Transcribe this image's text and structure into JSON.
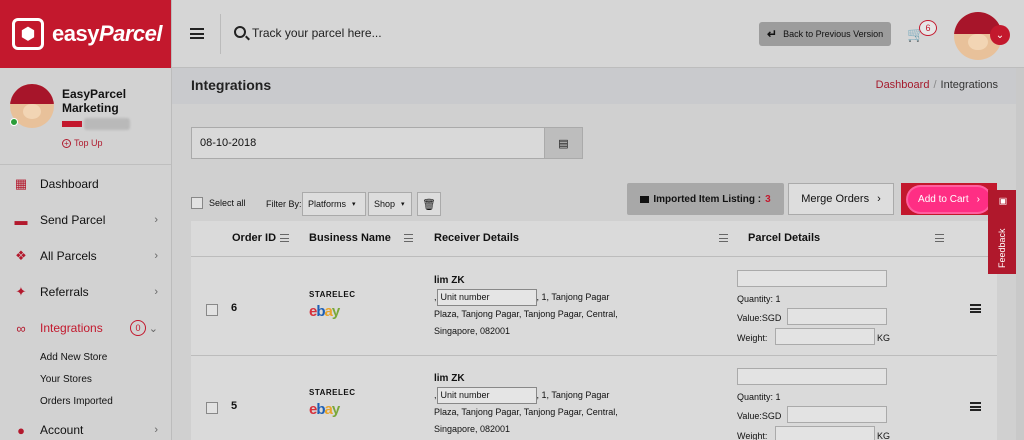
{
  "brand": {
    "logo_symbol": "⬢",
    "name_a": "easy",
    "name_b": "Parcel",
    "color": "#c3182d"
  },
  "profile": {
    "name": "EasyParcel Marketing",
    "topup": "Top Up",
    "status": "online"
  },
  "sidebar": {
    "items": [
      {
        "label": "Dashboard",
        "icon": "dashboard-icon",
        "glyph": "▦"
      },
      {
        "label": "Send Parcel",
        "icon": "truck-icon",
        "glyph": "▬",
        "chev": "›"
      },
      {
        "label": "All Parcels",
        "icon": "boxes-icon",
        "glyph": "❖",
        "chev": "›"
      },
      {
        "label": "Referrals",
        "icon": "users-icon",
        "glyph": "✦",
        "chev": "›"
      },
      {
        "label": "Integrations",
        "icon": "link-icon",
        "glyph": "∞",
        "badge": "0",
        "chev": "⌄"
      },
      {
        "label": "Account",
        "icon": "account-icon",
        "glyph": "●",
        "chev": "›"
      }
    ],
    "subitems": [
      "Add New Store",
      "Your Stores",
      "Orders Imported"
    ]
  },
  "topbar": {
    "search_placeholder": "Track your parcel here...",
    "back_label": "Back to Previous Version",
    "back_icon": "↵",
    "cart_icon": "🛒",
    "cart_count": "6",
    "avatar_chev": "⌄"
  },
  "page": {
    "title": "Integrations",
    "crumb_link": "Dashboard",
    "crumb_sep": "/",
    "crumb_current": "Integrations"
  },
  "filters": {
    "date": "08-10-2018",
    "calendar_icon": "▤",
    "select_all": "Select all",
    "filter_by": "Filter By:",
    "platforms": "Platforms",
    "shop": "Shop",
    "caret": "▾",
    "trash_icon": "🗑"
  },
  "actions": {
    "imported_label": "Imported Item Listing :",
    "imported_count": "3",
    "merge_label": "Merge Orders",
    "add_cart_label": "Add to Cart",
    "arrow": "›"
  },
  "feedback": {
    "label": "Feedback",
    "icon": "▣"
  },
  "table": {
    "headers": [
      "Order ID",
      "Business Name",
      "Receiver Details",
      "Parcel Details"
    ],
    "rows": [
      {
        "order_id": "6",
        "store": "STARELEC",
        "platform": [
          "e",
          "b",
          "a",
          "y"
        ],
        "receiver_name": "lim ZK",
        "unit_placeholder": "Unit number",
        "address_a": ", 1, Tanjong Pagar",
        "address_b": "Plaza, Tanjong Pagar, Tanjong Pagar, Central,",
        "address_c": "Singapore, 082001",
        "comma": ",",
        "quantity": "Quantity: 1",
        "value": "Value:SGD",
        "weight": "Weight:",
        "kg": "KG"
      },
      {
        "order_id": "5",
        "store": "STARELEC",
        "platform": [
          "e",
          "b",
          "a",
          "y"
        ],
        "receiver_name": "lim ZK",
        "unit_placeholder": "Unit number",
        "address_a": ", 1, Tanjong Pagar",
        "address_b": "Plaza, Tanjong Pagar, Tanjong Pagar, Central,",
        "address_c": "Singapore, 082001",
        "comma": ",",
        "quantity": "Quantity: 1",
        "value": "Value:SGD",
        "weight": "Weight:",
        "kg": "KG"
      }
    ]
  }
}
